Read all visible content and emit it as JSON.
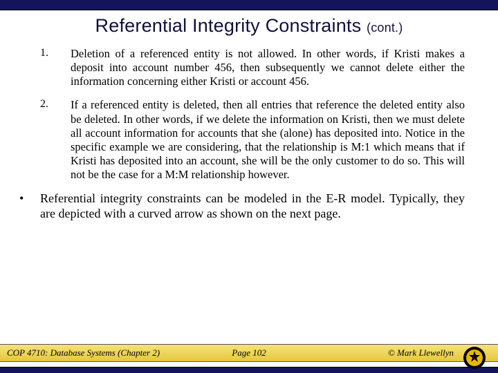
{
  "title": {
    "main": "Referential Integrity Constraints",
    "suffix": "(cont.)"
  },
  "items": [
    {
      "num": "1.",
      "text": "Deletion of a referenced entity is not allowed.  In other words, if Kristi makes a deposit into account number 456, then subsequently we cannot delete either the information concerning either Kristi or account 456."
    },
    {
      "num": "2.",
      "text": "If a referenced entity is deleted, then all entries that reference the deleted entity also be deleted.  In other words, if we delete the information on Kristi, then we must delete all account information for accounts that she (alone) has deposited into.  Notice in the specific example we are considering, that the relationship is M:1 which means that if Kristi has deposited into an account, she will be the only customer to do so.  This will not be the case for a M:M relationship however."
    }
  ],
  "bullet": {
    "symbol": "•",
    "text": "Referential integrity constraints can be modeled in the E-R model.  Typically, they are depicted with a curved arrow as shown on the next page."
  },
  "footer": {
    "left": "COP 4710: Database Systems  (Chapter 2)",
    "center": "Page 102",
    "right": "© Mark Llewellyn"
  }
}
